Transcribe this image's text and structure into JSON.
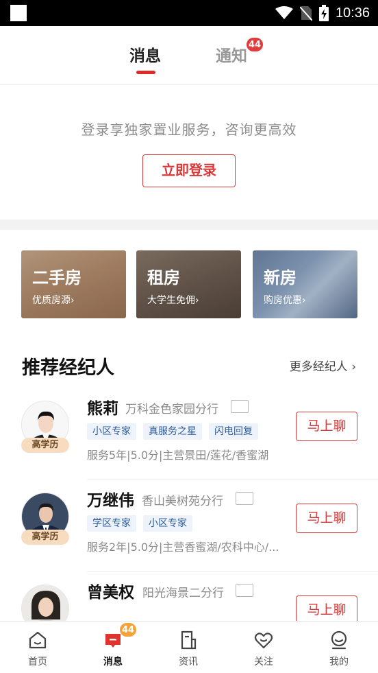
{
  "status_bar": {
    "time": "10:36"
  },
  "top_tabs": [
    {
      "label": "消息"
    },
    {
      "label": "通知",
      "badge": "44"
    }
  ],
  "login": {
    "tip": "登录享独家置业服务，咨询更高效",
    "button": "立即登录"
  },
  "categories": [
    {
      "title": "二手房",
      "subtitle": "优质房源›"
    },
    {
      "title": "租房",
      "subtitle": "大学生免佣›"
    },
    {
      "title": "新房",
      "subtitle": "购房优惠›"
    }
  ],
  "section": {
    "title": "推荐经纪人",
    "more": "更多经纪人 ›"
  },
  "agents": [
    {
      "name": "熊莉",
      "branch": "万科金色家园分行",
      "edu": "高学历",
      "tags": [
        "小区专家",
        "真服务之星",
        "闪电回复"
      ],
      "meta": "服务5年|5.0分|主营景田/莲花/香蜜湖",
      "chat": "马上聊"
    },
    {
      "name": "万继伟",
      "branch": "香山美树苑分行",
      "edu": "高学历",
      "tags": [
        "学区专家",
        "小区专家"
      ],
      "meta": "服务2年|5.0分|主营香蜜湖/农科中心/...",
      "chat": "马上聊"
    },
    {
      "name": "曾美权",
      "branch": "阳光海景二分行",
      "edu": "",
      "tags": [],
      "meta": "",
      "chat": "马上聊"
    }
  ],
  "tabbar": [
    {
      "label": "首页"
    },
    {
      "label": "消息",
      "badge": "44"
    },
    {
      "label": "资讯"
    },
    {
      "label": "关注"
    },
    {
      "label": "我的"
    }
  ],
  "colors": {
    "accent": "#d83a3a",
    "tag_bg": "#eef3fb",
    "tag_text": "#2e5c9a",
    "edu_bg": "#f7dcc0"
  }
}
